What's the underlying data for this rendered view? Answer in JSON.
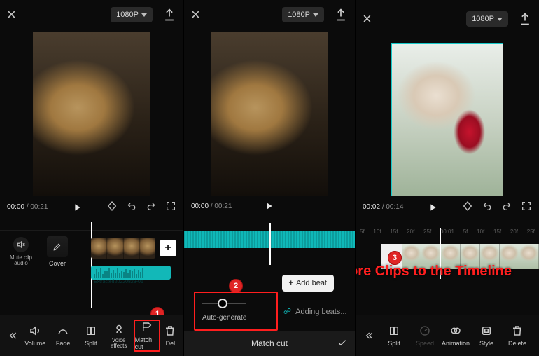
{
  "header": {
    "resolution_label": "1080P"
  },
  "time": {
    "p1_current": "00:00",
    "p1_total": "00:21",
    "p2_current": "00:00",
    "p2_total": "00:21",
    "p3_current": "00:02",
    "p3_total": "00:14"
  },
  "panel1": {
    "mute_clip_label": "Mute clip audio",
    "cover_label": "Cover",
    "audio_strip_label": "Extracted20220823-01",
    "toolbar": {
      "volume": "Volume",
      "fade": "Fade",
      "split": "Split",
      "voice_effects": "Voice effects",
      "match_cut": "Match cut",
      "delete": "Del"
    }
  },
  "panel2": {
    "add_beat_label": "Add beat",
    "auto_generate_label": "Auto-generate",
    "adding_beats_label": "Adding beats...",
    "match_cut_title": "Match cut"
  },
  "panel3": {
    "ruler": [
      "5f",
      "10f",
      "15f",
      "20f",
      "25f",
      "00:01",
      "5f",
      "10f",
      "15f",
      "20f",
      "25f"
    ],
    "toolbar": {
      "split": "Split",
      "speed": "Speed",
      "animation": "Animation",
      "style": "Style",
      "delete": "Delete"
    }
  },
  "callouts": {
    "n1": "1",
    "n2": "2",
    "n3": "3",
    "headline": "Add More Clips to the Timeline"
  }
}
